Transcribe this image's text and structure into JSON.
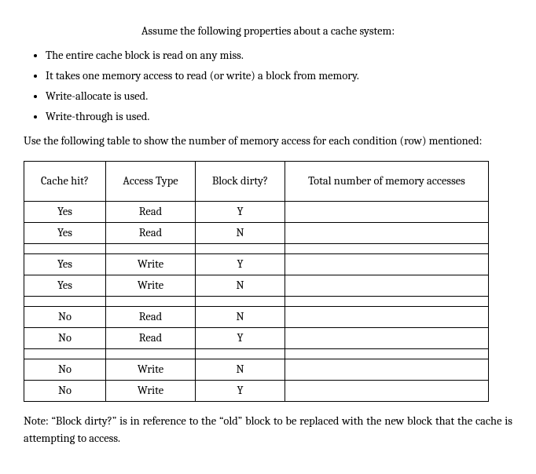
{
  "intro": "Assume the following properties about a cache system:",
  "properties": [
    "The entire cache block is read on any miss.",
    "It takes one memory access to read (or write) a block from memory.",
    "Write-allocate is used.",
    "Write-through is used."
  ],
  "instruction": "Use the following table to show the number of memory access for each condition (row) mentioned:",
  "table": {
    "headers": {
      "cache_hit": "Cache hit?",
      "access_type": "Access Type",
      "block_dirty": "Block dirty?",
      "total": "Total number of memory accesses"
    },
    "groups": [
      [
        {
          "cache_hit": "Yes",
          "access_type": "Read",
          "block_dirty": "Y",
          "total": ""
        },
        {
          "cache_hit": "Yes",
          "access_type": "Read",
          "block_dirty": "N",
          "total": ""
        }
      ],
      [
        {
          "cache_hit": "Yes",
          "access_type": "Write",
          "block_dirty": "Y",
          "total": ""
        },
        {
          "cache_hit": "Yes",
          "access_type": "Write",
          "block_dirty": "N",
          "total": ""
        }
      ],
      [
        {
          "cache_hit": "No",
          "access_type": "Read",
          "block_dirty": "N",
          "total": ""
        },
        {
          "cache_hit": "No",
          "access_type": "Read",
          "block_dirty": "Y",
          "total": ""
        }
      ],
      [
        {
          "cache_hit": "No",
          "access_type": "Write",
          "block_dirty": "N",
          "total": ""
        },
        {
          "cache_hit": "No",
          "access_type": "Write",
          "block_dirty": "Y",
          "total": ""
        }
      ]
    ]
  },
  "note": "Note: “Block dirty?” is in reference to the “old” block to be replaced with the new block that the cache is attempting to access."
}
